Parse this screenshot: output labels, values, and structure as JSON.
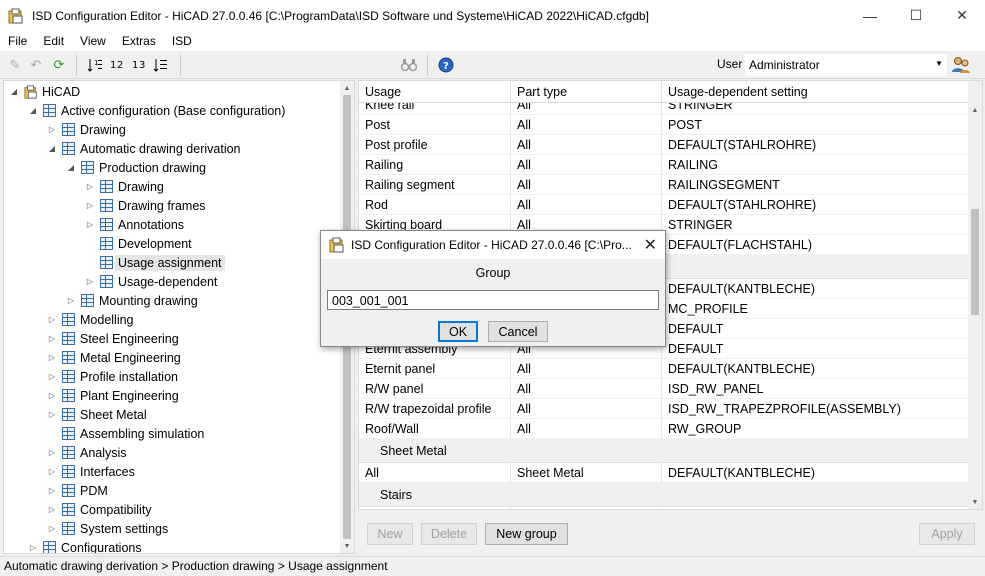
{
  "window": {
    "title": "ISD Configuration Editor  - HiCAD 27.0.0.46 [C:\\ProgramData\\ISD Software und Systeme\\HiCAD 2022\\HiCAD.cfgdb]",
    "minimize": "—",
    "maximize": "☐",
    "close": "✕"
  },
  "menu": [
    "File",
    "Edit",
    "View",
    "Extras",
    "ISD"
  ],
  "toolbar": {
    "user_label": "User",
    "user_value": "Administrator",
    "icons": [
      "pencil-icon",
      "undo-icon",
      "refresh-icon",
      "sort-level1-icon",
      "sort-level2-icon",
      "sort-level3-icon",
      "sort-all-icon",
      "binoculars-icon",
      "help-icon",
      "users-icon"
    ]
  },
  "tree": {
    "items": [
      {
        "label": "HiCAD",
        "level": 0,
        "expand": "expanded",
        "root": true
      },
      {
        "label": "Active configuration (Base configuration)",
        "level": 1,
        "expand": "expanded"
      },
      {
        "label": "Drawing",
        "level": 2,
        "expand": "collapsed"
      },
      {
        "label": "Automatic drawing derivation",
        "level": 2,
        "expand": "expanded"
      },
      {
        "label": "Production drawing",
        "level": 3,
        "expand": "expanded"
      },
      {
        "label": "Drawing",
        "level": 4,
        "expand": "collapsed"
      },
      {
        "label": "Drawing frames",
        "level": 4,
        "expand": "collapsed"
      },
      {
        "label": "Annotations",
        "level": 4,
        "expand": "collapsed"
      },
      {
        "label": "Development",
        "level": 4,
        "expand": "none"
      },
      {
        "label": "Usage assignment",
        "level": 4,
        "expand": "none",
        "selected": true
      },
      {
        "label": "Usage-dependent",
        "level": 4,
        "expand": "collapsed"
      },
      {
        "label": "Mounting drawing",
        "level": 3,
        "expand": "collapsed"
      },
      {
        "label": "Modelling",
        "level": 2,
        "expand": "collapsed"
      },
      {
        "label": "Steel Engineering",
        "level": 2,
        "expand": "collapsed"
      },
      {
        "label": "Metal Engineering",
        "level": 2,
        "expand": "collapsed"
      },
      {
        "label": "Profile installation",
        "level": 2,
        "expand": "collapsed"
      },
      {
        "label": "Plant Engineering",
        "level": 2,
        "expand": "collapsed"
      },
      {
        "label": "Sheet Metal",
        "level": 2,
        "expand": "collapsed"
      },
      {
        "label": "Assembling simulation",
        "level": 2,
        "expand": "none"
      },
      {
        "label": "Analysis",
        "level": 2,
        "expand": "collapsed"
      },
      {
        "label": "Interfaces",
        "level": 2,
        "expand": "collapsed"
      },
      {
        "label": "PDM",
        "level": 2,
        "expand": "collapsed"
      },
      {
        "label": "Compatibility",
        "level": 2,
        "expand": "collapsed"
      },
      {
        "label": "System settings",
        "level": 2,
        "expand": "collapsed"
      },
      {
        "label": "Configurations",
        "level": 1,
        "expand": "collapsed"
      }
    ]
  },
  "grid": {
    "columns": [
      "Usage",
      "Part type",
      "Usage-dependent setting"
    ],
    "rows": [
      {
        "kind": "row",
        "cells": [
          "Knee rail",
          "All",
          "STRINGER"
        ]
      },
      {
        "kind": "row",
        "cells": [
          "Post",
          "All",
          "POST"
        ]
      },
      {
        "kind": "row",
        "cells": [
          "Post profile",
          "All",
          "DEFAULT(STAHLROHRE)"
        ]
      },
      {
        "kind": "row",
        "cells": [
          "Railing",
          "All",
          "RAILING"
        ]
      },
      {
        "kind": "row",
        "cells": [
          "Railing segment",
          "All",
          "RAILINGSEGMENT"
        ]
      },
      {
        "kind": "row",
        "cells": [
          "Rod",
          "All",
          "DEFAULT(STAHLROHRE)"
        ]
      },
      {
        "kind": "row",
        "cells": [
          "Skirting board",
          "All",
          "STRINGER"
        ]
      },
      {
        "kind": "row",
        "cells": [
          "",
          "",
          "DEFAULT(FLACHSTAHL)"
        ]
      },
      {
        "kind": "group",
        "label": ""
      },
      {
        "kind": "row",
        "cells": [
          "",
          "",
          "DEFAULT(KANTBLECHE)"
        ]
      },
      {
        "kind": "row",
        "cells": [
          "",
          "",
          "MC_PROFILE"
        ]
      },
      {
        "kind": "row",
        "cells": [
          "",
          "",
          "DEFAULT"
        ]
      },
      {
        "kind": "row",
        "cells": [
          "Eternit assembly",
          "All",
          "DEFAULT"
        ]
      },
      {
        "kind": "row",
        "cells": [
          "Eternit panel",
          "All",
          "DEFAULT(KANTBLECHE)"
        ]
      },
      {
        "kind": "row",
        "cells": [
          "R/W panel",
          "All",
          "ISD_RW_PANEL"
        ]
      },
      {
        "kind": "row",
        "cells": [
          "R/W trapezoidal profile",
          "All",
          "ISD_RW_TRAPEZPROFILE(ASSEMBLY)"
        ]
      },
      {
        "kind": "row",
        "cells": [
          "Roof/Wall",
          "All",
          "RW_GROUP"
        ]
      },
      {
        "kind": "group",
        "label": "Sheet Metal"
      },
      {
        "kind": "row",
        "cells": [
          "All",
          "Sheet Metal",
          "DEFAULT(KANTBLECHE)"
        ]
      },
      {
        "kind": "group",
        "label": "Stairs"
      },
      {
        "kind": "row",
        "cells": [
          "",
          "",
          ""
        ]
      }
    ]
  },
  "buttons": {
    "new": "New",
    "delete": "Delete",
    "new_group": "New group",
    "apply": "Apply"
  },
  "status": "Automatic drawing derivation > Production drawing > Usage assignment",
  "dialog": {
    "title": "ISD Configuration Editor  - HiCAD 27.0.0.46 [C:\\Pro...",
    "close": "✕",
    "label": "Group",
    "input_value": "003_001_001",
    "ok": "OK",
    "cancel": "Cancel"
  }
}
